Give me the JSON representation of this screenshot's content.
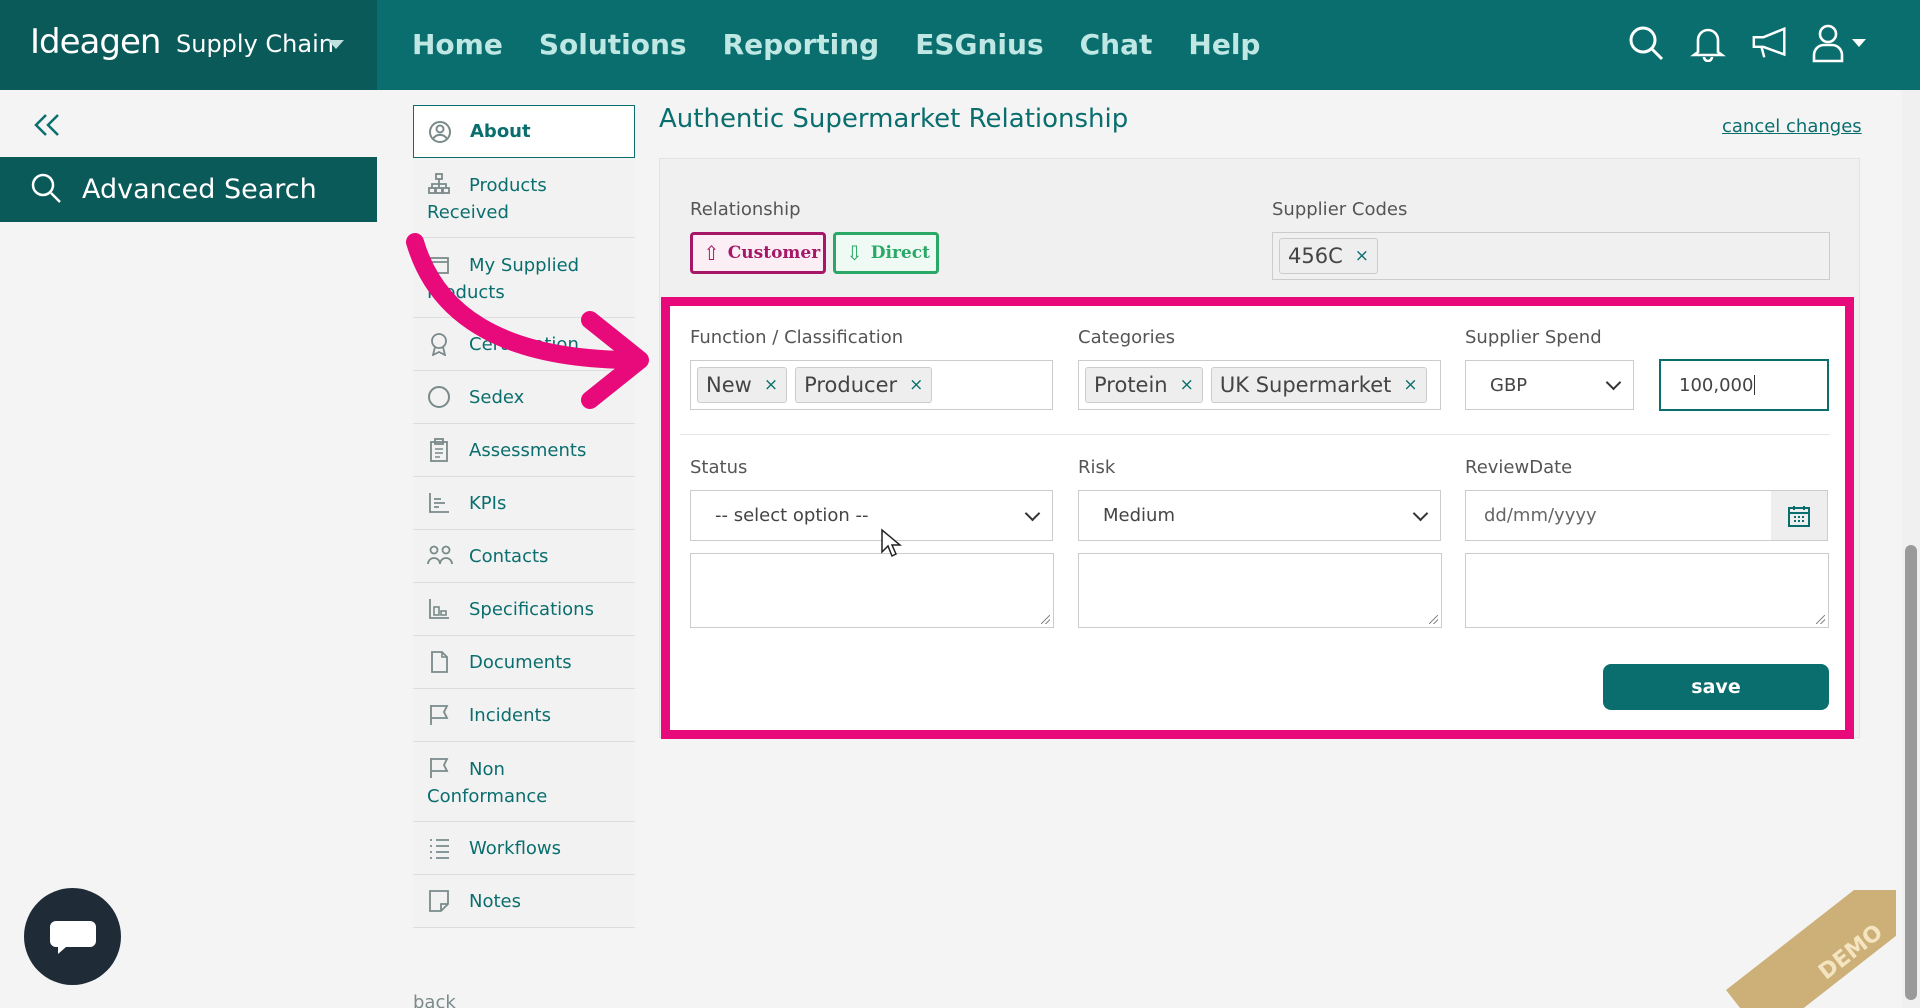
{
  "header": {
    "brand": "Ideagen",
    "product": "Supply Chain",
    "nav": [
      "Home",
      "Solutions",
      "Reporting",
      "ESGnius",
      "Chat",
      "Help"
    ],
    "icons": [
      "search-icon",
      "bell-icon",
      "megaphone-icon",
      "user-icon"
    ]
  },
  "sidebar": {
    "advanced_search": "Advanced Search"
  },
  "subnav": {
    "items": [
      {
        "label": "About",
        "icon": "user-circle-icon",
        "active": true
      },
      {
        "label": "Products Received",
        "icon": "hierarchy-icon"
      },
      {
        "label": "My Supplied Products",
        "icon": "box-icon"
      },
      {
        "label": "Certification",
        "icon": "award-icon"
      },
      {
        "label": "Sedex",
        "icon": "circle-icon"
      },
      {
        "label": "Assessments",
        "icon": "clipboard-icon"
      },
      {
        "label": "KPIs",
        "icon": "chart-icon"
      },
      {
        "label": "Contacts",
        "icon": "people-icon"
      },
      {
        "label": "Specifications",
        "icon": "spec-icon"
      },
      {
        "label": "Documents",
        "icon": "document-icon"
      },
      {
        "label": "Incidents",
        "icon": "flag-icon"
      },
      {
        "label": "Non Conformance",
        "icon": "flag-icon"
      },
      {
        "label": "Workflows",
        "icon": "list-icon"
      },
      {
        "label": "Notes",
        "icon": "note-icon"
      }
    ],
    "back": "back"
  },
  "main": {
    "title": "Authentic Supermarket Relationship",
    "cancel": "cancel changes",
    "relationship_label": "Relationship",
    "relationship_buttons": [
      "Customer",
      "Direct"
    ],
    "supplier_codes_label": "Supplier Codes",
    "supplier_codes": [
      "456C"
    ],
    "function_label": "Function / Classification",
    "function_tags": [
      "New",
      "Producer"
    ],
    "categories_label": "Categories",
    "categories_tags": [
      "Protein",
      "UK Supermarket"
    ],
    "spend_label": "Supplier Spend",
    "currency": "GBP",
    "spend_value": "100,000",
    "status_label": "Status",
    "status_value": "-- select option --",
    "risk_label": "Risk",
    "risk_value": "Medium",
    "review_label": "ReviewDate",
    "review_placeholder": "dd/mm/yyyy",
    "save": "save"
  },
  "demo": "DEMO",
  "colors": {
    "primary": "#0b6e6e",
    "highlight": "#e8097a",
    "customer": "#a61867",
    "direct": "#2aa866"
  }
}
